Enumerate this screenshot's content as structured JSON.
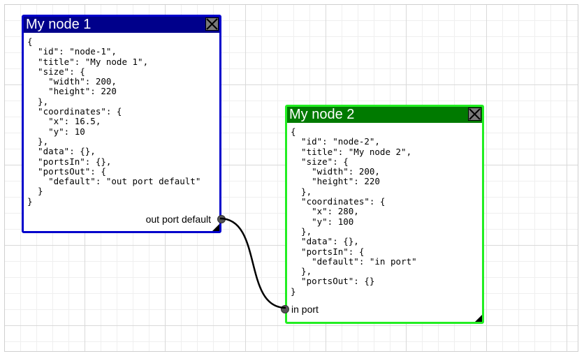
{
  "nodes": [
    {
      "title": "My node 1",
      "content": "{\n  \"id\": \"node-1\",\n  \"title\": \"My node 1\",\n  \"size\": {\n    \"width\": 200,\n    \"height\": 220\n  },\n  \"coordinates\": {\n    \"x\": 16.5,\n    \"y\": 10\n  },\n  \"data\": {},\n  \"portsIn\": {},\n  \"portsOut\": {\n    \"default\": \"out port default\"\n  }\n}",
      "port_label": "out port default",
      "header_color": "#00008b",
      "border_color": "#0000cc"
    },
    {
      "title": "My node 2",
      "content": "{\n  \"id\": \"node-2\",\n  \"title\": \"My node 2\",\n  \"size\": {\n    \"width\": 200,\n    \"height\": 220\n  },\n  \"coordinates\": {\n    \"x\": 280,\n    \"y\": 100\n  },\n  \"data\": {},\n  \"portsIn\": {\n    \"default\": \"in port\"\n  },\n  \"portsOut\": {}\n}",
      "port_label": "in port",
      "header_color": "#007a00",
      "border_color": "#22ee22"
    }
  ],
  "icons": {
    "close": "close-icon"
  },
  "link_color": "#000000"
}
